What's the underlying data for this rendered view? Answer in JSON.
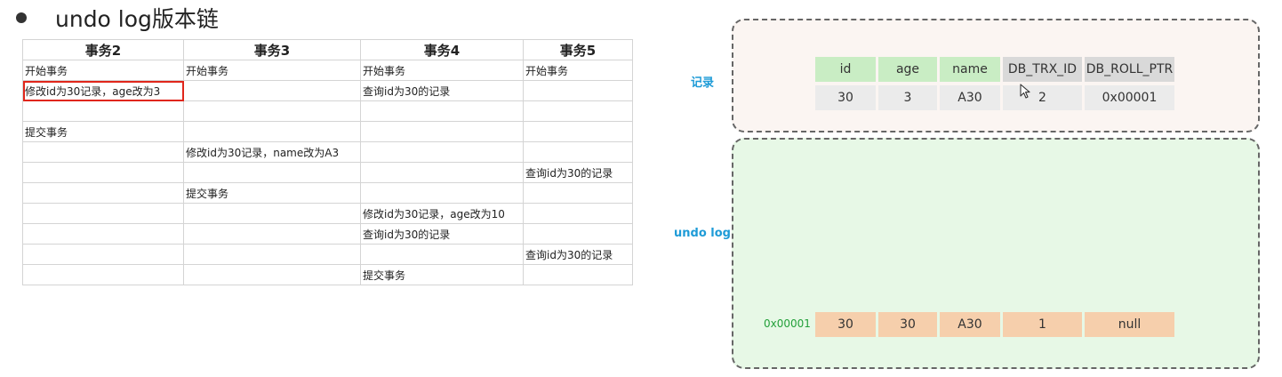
{
  "heading": "undo log版本链",
  "table": {
    "headers": [
      "事务2",
      "事务3",
      "事务4",
      "事务5"
    ],
    "rows": [
      [
        "开始事务",
        "开始事务",
        "开始事务",
        "开始事务"
      ],
      [
        "修改id为30记录，age改为3",
        "",
        "查询id为30的记录",
        ""
      ],
      [
        "",
        "",
        "",
        ""
      ],
      [
        "提交事务",
        "",
        "",
        ""
      ],
      [
        "",
        "修改id为30记录，name改为A3",
        "",
        ""
      ],
      [
        "",
        "",
        "",
        "查询id为30的记录"
      ],
      [
        "",
        "提交事务",
        "",
        ""
      ],
      [
        "",
        "",
        "修改id为30记录，age改为10",
        ""
      ],
      [
        "",
        "",
        "查询id为30的记录",
        ""
      ],
      [
        "",
        "",
        "",
        "查询id为30的记录"
      ],
      [
        "",
        "",
        "提交事务",
        ""
      ]
    ]
  },
  "record": {
    "label": "记录",
    "columns": [
      "id",
      "age",
      "name",
      "DB_TRX_ID",
      "DB_ROLL_PTR"
    ],
    "values": [
      "30",
      "3",
      "A30",
      "2",
      "0x00001"
    ]
  },
  "undo": {
    "label": "undo log",
    "address": "0x00001",
    "values": [
      "30",
      "30",
      "A30",
      "1",
      "null"
    ]
  },
  "colors": {
    "highlight": "#e0261b",
    "label_blue": "#1e9bd7",
    "address_green": "#23a03a",
    "header_green": "#c9edc4",
    "header_gray": "#d9d9d9",
    "undo_peach": "#f6cfac"
  }
}
